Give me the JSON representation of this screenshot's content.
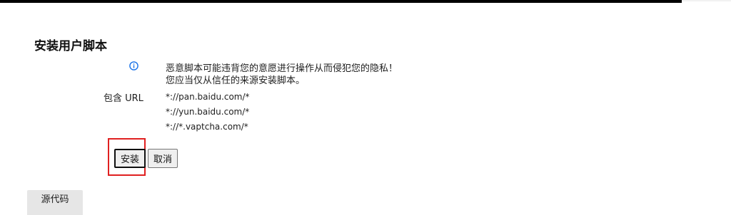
{
  "header": {
    "title": "安装用户脚本"
  },
  "warning": {
    "icon": "info-icon",
    "icon_color": "#1a73e8",
    "line1": "恶意脚本可能违背您的意愿进行操作从而侵犯您的隐私！",
    "line2": "您应当仅从信任的来源安装脚本。"
  },
  "includes": {
    "label": "包含 URL",
    "urls": [
      "*://pan.baidu.com/*",
      "*://yun.baidu.com/*",
      "*://*.vaptcha.com/*"
    ]
  },
  "actions": {
    "install_label": "安装",
    "cancel_label": "取消",
    "highlight_color": "#e02020"
  },
  "tabs": {
    "source_label": "源代码"
  }
}
